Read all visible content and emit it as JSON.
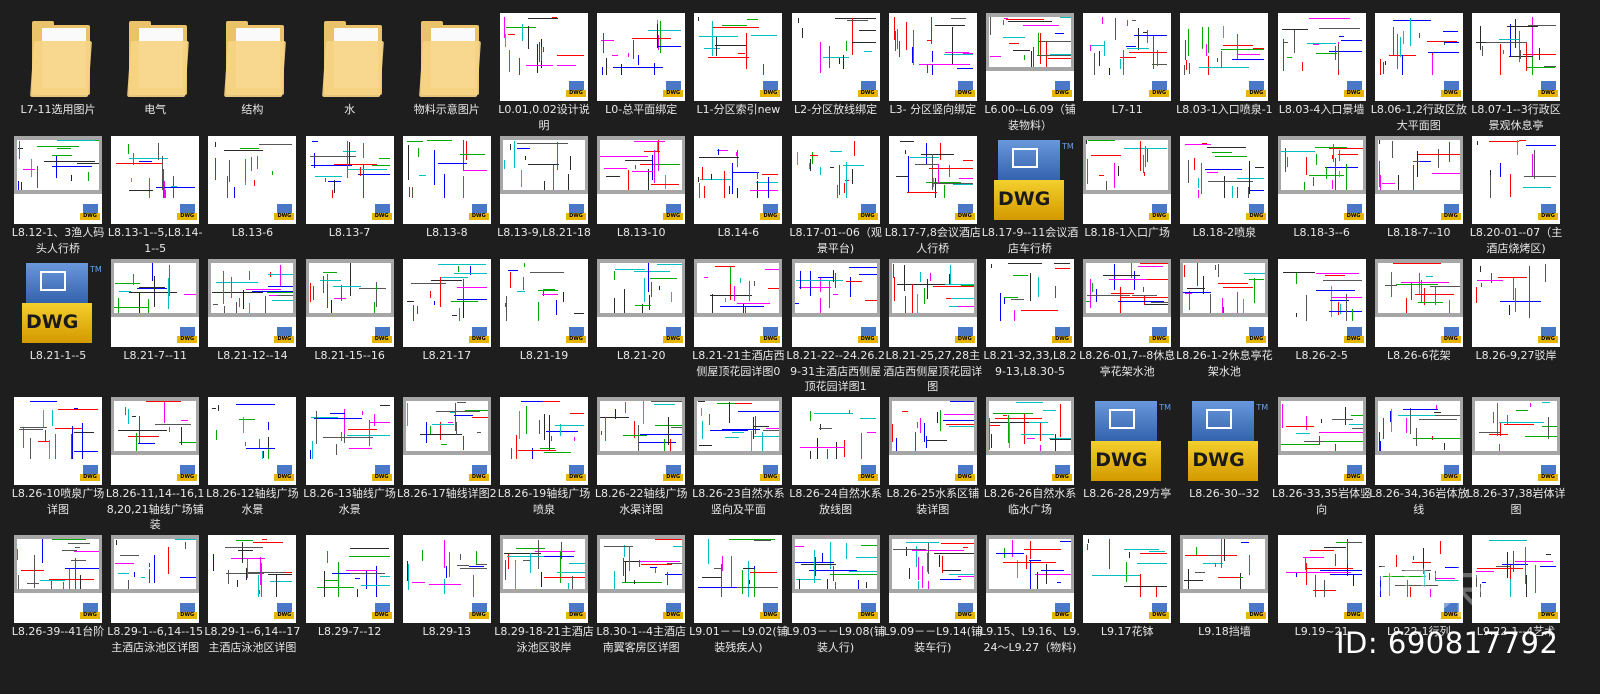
{
  "items": [
    {
      "label": "L7-11选用图片",
      "kind": "folder"
    },
    {
      "label": "电气",
      "kind": "folder"
    },
    {
      "label": "结构",
      "kind": "folder"
    },
    {
      "label": "水",
      "kind": "folder"
    },
    {
      "label": "物料示意图片",
      "kind": "folder"
    },
    {
      "label": "L0.01,0.02设计说明",
      "kind": "white"
    },
    {
      "label": "L0-总平面绑定",
      "kind": "white"
    },
    {
      "label": "L1-分区索引new",
      "kind": "white"
    },
    {
      "label": "L2-分区放线绑定",
      "kind": "white"
    },
    {
      "label": "L3- 分区竖向绑定",
      "kind": "white"
    },
    {
      "label": "L6.00--L6.09（铺装物料）",
      "kind": "gray"
    },
    {
      "label": "L7-11",
      "kind": "white"
    },
    {
      "label": "L8.03-1入口喷泉-1",
      "kind": "white"
    },
    {
      "label": "L8.03-4入口景墙",
      "kind": "white"
    },
    {
      "label": "L8.06-1,2行政区放大平面图",
      "kind": "white"
    },
    {
      "label": "L8.07-1--3行政区景观休息亭",
      "kind": "white"
    },
    {
      "label": "L8.12-1、3渔人码头人行桥",
      "kind": "gray"
    },
    {
      "label": "L8.13-1--5,L8.14-1--5",
      "kind": "white"
    },
    {
      "label": "L8.13-6",
      "kind": "white"
    },
    {
      "label": "L8.13-7",
      "kind": "white"
    },
    {
      "label": "L8.13-8",
      "kind": "white"
    },
    {
      "label": "L8.13-9,L8.21-18",
      "kind": "gray"
    },
    {
      "label": "L8.13-10",
      "kind": "gray"
    },
    {
      "label": "L8.14-6",
      "kind": "white"
    },
    {
      "label": "L8.17-01--06（观景平台)",
      "kind": "white"
    },
    {
      "label": "L8.17-7,8会议酒店人行桥",
      "kind": "white"
    },
    {
      "label": "L8.17-9--11会议酒店车行桥",
      "kind": "dwg"
    },
    {
      "label": "L8.18-1入口广场",
      "kind": "gray"
    },
    {
      "label": "L8.18-2喷泉",
      "kind": "white"
    },
    {
      "label": "L8.18-3--6",
      "kind": "gray"
    },
    {
      "label": "L8.18-7--10",
      "kind": "gray"
    },
    {
      "label": "L8.20-01--07（主酒店烧烤区)",
      "kind": "white"
    },
    {
      "label": "L8.21-1--5",
      "kind": "dwg"
    },
    {
      "label": "L8.21-7--11",
      "kind": "gray"
    },
    {
      "label": "L8.21-12--14",
      "kind": "gray"
    },
    {
      "label": "L8.21-15--16",
      "kind": "gray"
    },
    {
      "label": "L8.21-17",
      "kind": "white"
    },
    {
      "label": "L8.21-19",
      "kind": "white"
    },
    {
      "label": "L8.21-20",
      "kind": "gray"
    },
    {
      "label": "L8.21-21主酒店西侧屋顶花园详图0",
      "kind": "gray"
    },
    {
      "label": "L8.21-22--24.26.29-31主酒店西侧屋顶花园详图1",
      "kind": "gray"
    },
    {
      "label": "L8.21-25,27,28主酒店西侧屋顶花园详图",
      "kind": "gray"
    },
    {
      "label": "L8.21-32,33,L8.29-13,L8.30-5",
      "kind": "white"
    },
    {
      "label": "L8.26-01,7--8休息亭花架水池",
      "kind": "gray"
    },
    {
      "label": "L8.26-1-2休息亭花架水池",
      "kind": "gray"
    },
    {
      "label": "L8.26-2-5",
      "kind": "white"
    },
    {
      "label": "L8.26-6花架",
      "kind": "gray"
    },
    {
      "label": "L8.26-9,27驳岸",
      "kind": "white"
    },
    {
      "label": "L8.26-10喷泉广场详图",
      "kind": "white"
    },
    {
      "label": "L8.26-11,14--16,18,20,21轴线广场铺装",
      "kind": "gray"
    },
    {
      "label": "L8.26-12轴线广场水景",
      "kind": "white"
    },
    {
      "label": "L8.26-13轴线广场水景",
      "kind": "white"
    },
    {
      "label": "L8.26-17轴线详图2",
      "kind": "gray"
    },
    {
      "label": "L8.26-19轴线广场喷泉",
      "kind": "white"
    },
    {
      "label": "L8.26-22轴线广场水渠详图",
      "kind": "gray"
    },
    {
      "label": "L8.26-23自然水系竖向及平面",
      "kind": "gray"
    },
    {
      "label": "L8.26-24自然水系放线图",
      "kind": "white"
    },
    {
      "label": "L8.26-25水系区铺装详图",
      "kind": "gray"
    },
    {
      "label": "L8.26-26自然水系临水广场",
      "kind": "gray"
    },
    {
      "label": "L8.26-28,29方亭",
      "kind": "dwg"
    },
    {
      "label": "L8.26-30--32",
      "kind": "dwg"
    },
    {
      "label": "L8.26-33,35岩体竖向",
      "kind": "gray"
    },
    {
      "label": "L8.26-34,36岩体放线",
      "kind": "gray"
    },
    {
      "label": "L8.26-37,38岩体详图",
      "kind": "gray"
    },
    {
      "label": "L8.26-39--41台阶",
      "kind": "gray"
    },
    {
      "label": "L8.29-1--6,14--15主酒店泳池区详图",
      "kind": "gray"
    },
    {
      "label": "L8.29-1--6,14--17主酒店泳池区详图",
      "kind": "white"
    },
    {
      "label": "L8.29-7--12",
      "kind": "white"
    },
    {
      "label": "L8.29-13",
      "kind": "white"
    },
    {
      "label": "L8.29-18-21主酒店泳池区驳岸",
      "kind": "gray"
    },
    {
      "label": "L8.30-1--4主酒店南翼客房区详图",
      "kind": "gray"
    },
    {
      "label": "L9.01－－L9.02(铺装残疾人)",
      "kind": "white"
    },
    {
      "label": "L9.03－－L9.08(铺装人行)",
      "kind": "gray"
    },
    {
      "label": "L9.09－－L9.14(铺装车行)",
      "kind": "gray"
    },
    {
      "label": "L9.15、L9.16、L9.24～L9.27（物料)",
      "kind": "gray"
    },
    {
      "label": "L9.17花钵",
      "kind": "white"
    },
    {
      "label": "L9.18挡墙",
      "kind": "gray"
    },
    {
      "label": "L9.19~21",
      "kind": "white"
    },
    {
      "label": "L9.22-1行列",
      "kind": "white"
    },
    {
      "label": "L9.22-1--4艺术",
      "kind": "white"
    }
  ],
  "badge_text": "DWG",
  "dwg_icon_text": "DWG",
  "dwg_icon_tm": "TM",
  "watermark": "知末",
  "id_text": "ID: 690817792",
  "colors": {
    "background": "#1e1e1e",
    "label": "#e8e8e8",
    "badge_blue": "#4a78c6",
    "badge_yellow": "#e6b500",
    "drawing_gray": "#a6a6a6"
  }
}
